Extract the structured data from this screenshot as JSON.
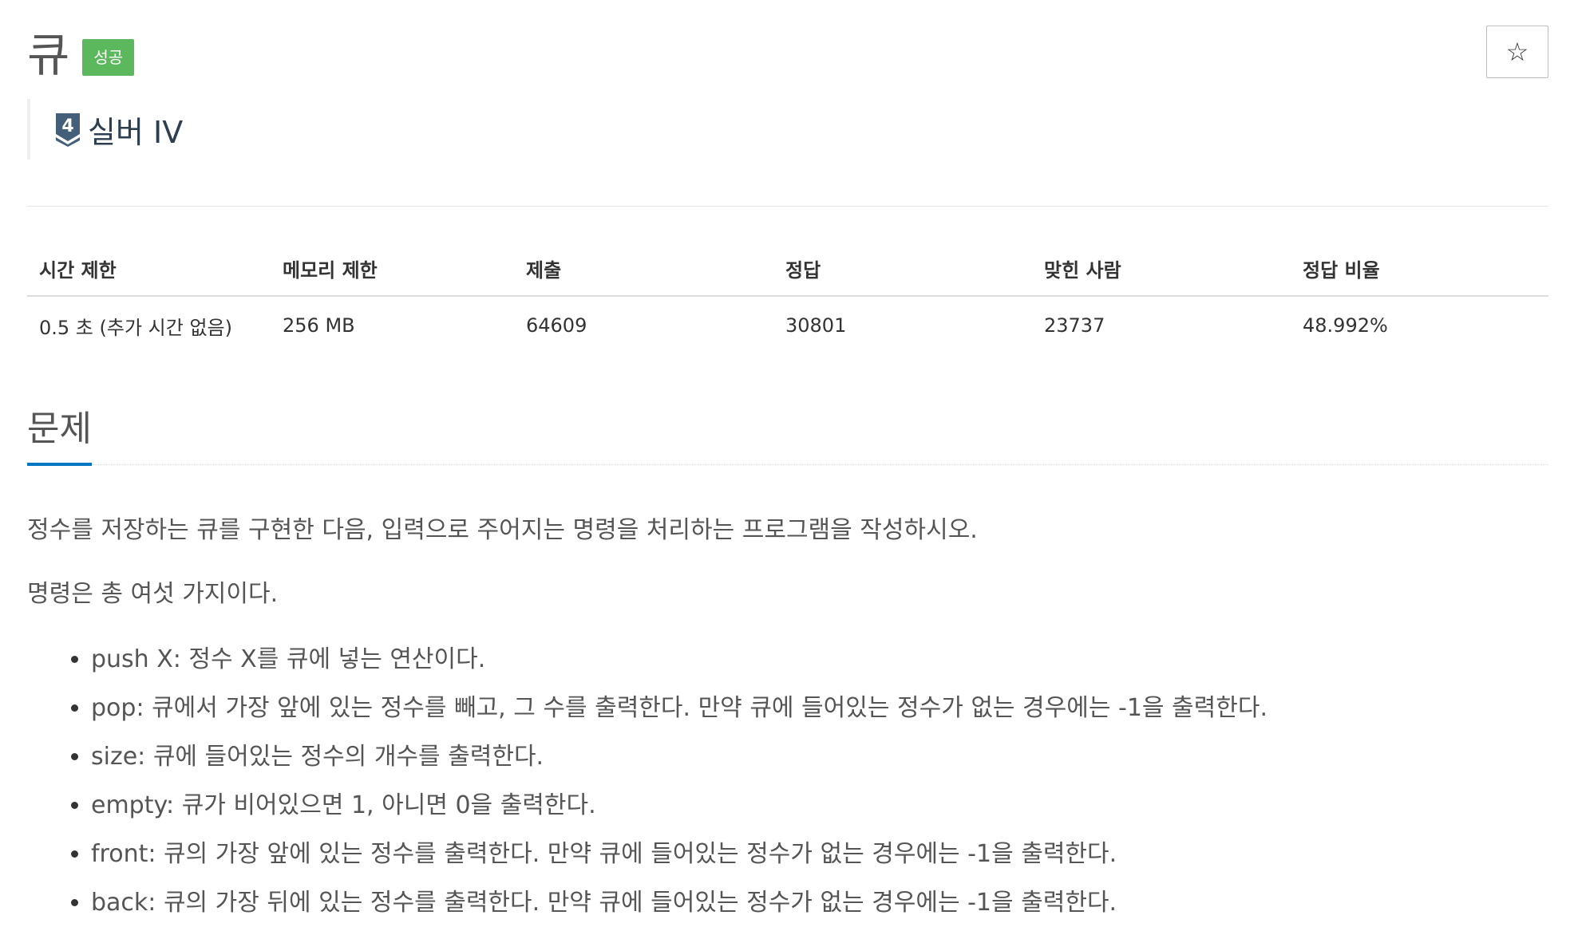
{
  "problem": {
    "title": "큐",
    "status_badge": "성공",
    "star_icon": "☆",
    "tier": {
      "level": "4",
      "label": "실버 IV"
    }
  },
  "info_table": {
    "headers": [
      "시간 제한",
      "메모리 제한",
      "제출",
      "정답",
      "맞힌 사람",
      "정답 비율"
    ],
    "values": [
      "0.5 초 (추가 시간 없음)",
      "256 MB",
      "64609",
      "30801",
      "23737",
      "48.992%"
    ]
  },
  "section": {
    "heading": "문제",
    "intro": "정수를 저장하는 큐를 구현한 다음, 입력으로 주어지는 명령을 처리하는 프로그램을 작성하시오.",
    "intro2": "명령은 총 여섯 가지이다.",
    "commands": [
      "push X: 정수 X를 큐에 넣는 연산이다.",
      "pop: 큐에서 가장 앞에 있는 정수를 빼고, 그 수를 출력한다. 만약 큐에 들어있는 정수가 없는 경우에는 -1을 출력한다.",
      "size: 큐에 들어있는 정수의 개수를 출력한다.",
      "empty: 큐가 비어있으면 1, 아니면 0을 출력한다.",
      "front: 큐의 가장 앞에 있는 정수를 출력한다. 만약 큐에 들어있는 정수가 없는 경우에는 -1을 출력한다.",
      "back: 큐의 가장 뒤에 있는 정수를 출력한다. 만약 큐에 들어있는 정수가 없는 경우에는 -1을 출력한다."
    ]
  },
  "colors": {
    "success_badge": "#5cb85c",
    "tier_silver": "#435f7a",
    "heading_underline": "#0076c0"
  },
  "icons": {
    "star": "star-outline-icon",
    "tier": "silver-tier-shield-icon"
  }
}
